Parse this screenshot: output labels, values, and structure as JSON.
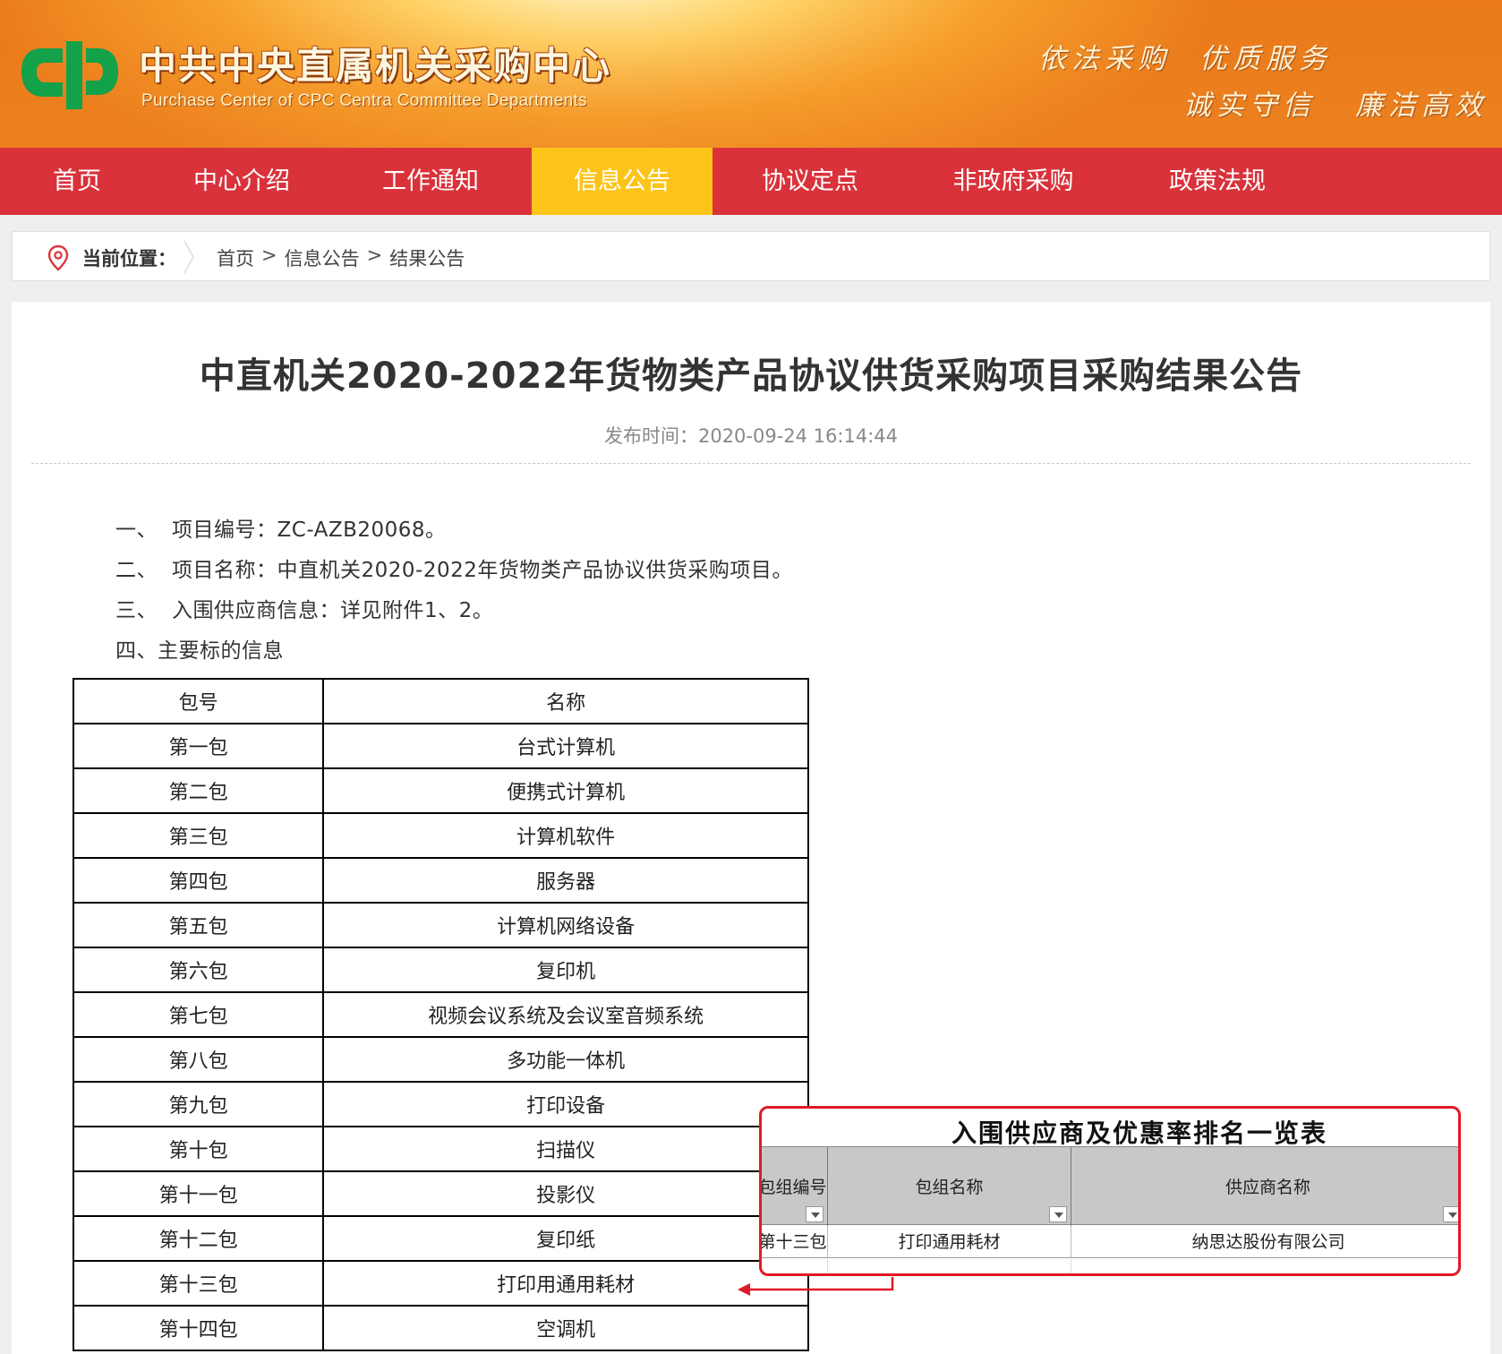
{
  "header": {
    "site_title": "中共中央直属机关采购中心",
    "site_subtitle": "Purchase Center of CPC Centra Committee Departments",
    "slogans": [
      "依法采购",
      "优质服务",
      "诚实守信",
      "廉洁高效"
    ],
    "logo_icon": "cpc-purchase-logo",
    "colors": {
      "logo_green": "#13a14a",
      "banner_orange": "#f39a2b"
    }
  },
  "nav": {
    "items": [
      {
        "label": "首页"
      },
      {
        "label": "中心介绍"
      },
      {
        "label": "工作通知"
      },
      {
        "label": "信息公告",
        "active": true
      },
      {
        "label": "协议定点"
      },
      {
        "label": "非政府采购"
      },
      {
        "label": "政策法规"
      }
    ],
    "colors": {
      "bar": "#d9323b",
      "active": "#fcc419"
    }
  },
  "breadcrumb": {
    "label": "当前位置：",
    "path": [
      "首页",
      "信息公告",
      "结果公告"
    ],
    "separator": ">",
    "icon": "location-pin-icon"
  },
  "article": {
    "title": "中直机关2020-2022年货物类产品协议供货采购项目采购结果公告",
    "date_label": "发布时间：",
    "date_value": "2020-09-24 16:14:44",
    "paragraphs": [
      {
        "num": "一、",
        "text": "项目编号：ZC-AZB20068。"
      },
      {
        "num": "二、",
        "text": "项目名称：中直机关2020-2022年货物类产品协议供货采购项目。"
      },
      {
        "num": "三、",
        "text": "入围供应商信息：详见附件1、2。"
      }
    ],
    "section4": "四、主要标的信息",
    "table": {
      "headers": [
        "包号",
        "名称"
      ],
      "rows": [
        [
          "第一包",
          "台式计算机"
        ],
        [
          "第二包",
          "便携式计算机"
        ],
        [
          "第三包",
          "计算机软件"
        ],
        [
          "第四包",
          "服务器"
        ],
        [
          "第五包",
          "计算机网络设备"
        ],
        [
          "第六包",
          "复印机"
        ],
        [
          "第七包",
          "视频会议系统及会议室音频系统"
        ],
        [
          "第八包",
          "多功能一体机"
        ],
        [
          "第九包",
          "打印设备"
        ],
        [
          "第十包",
          "扫描仪"
        ],
        [
          "第十一包",
          "投影仪"
        ],
        [
          "第十二包",
          "复印纸"
        ],
        [
          "第十三包",
          "打印用通用耗材"
        ],
        [
          "第十四包",
          "空调机"
        ]
      ]
    }
  },
  "inset": {
    "title": "入围供应商及优惠率排名一览表",
    "headers": [
      "包组编号",
      "包组名称",
      "供应商名称"
    ],
    "row": [
      "第十三包",
      "打印通用耗材",
      "纳思达股份有限公司"
    ],
    "colors": {
      "border": "#e01a26",
      "header_bg": "#c8c8c8"
    }
  }
}
